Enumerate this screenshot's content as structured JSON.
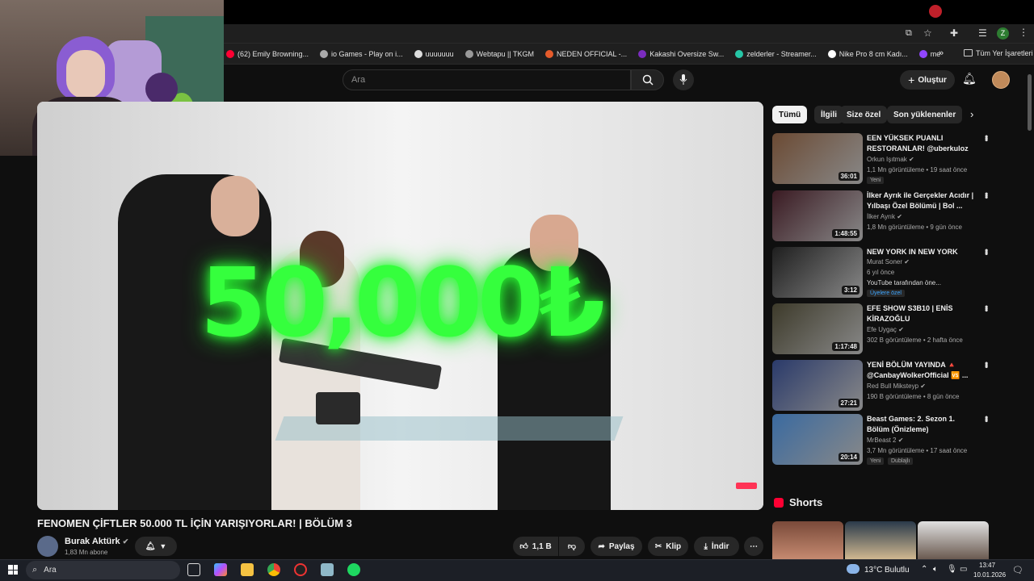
{
  "browser": {
    "bookmarks": [
      {
        "label": "(62) Emily Browning...",
        "icon": "youtube-icon",
        "color": "#ff0033"
      },
      {
        "label": "io Games - Play on i...",
        "icon": "games-icon",
        "color": "#aaaaaa"
      },
      {
        "label": "uuuuuuu",
        "icon": "github-icon",
        "color": "#dddddd"
      },
      {
        "label": "Webtapu || TKGM",
        "icon": "webtapu-icon",
        "color": "#999999"
      },
      {
        "label": "NEDEN OFFICIAL -...",
        "icon": "neden-icon",
        "color": "#e55b2b"
      },
      {
        "label": "Kakashi Oversize Sw...",
        "icon": "kakashi-icon",
        "color": "#7b2cbf"
      },
      {
        "label": "zelderler - Streamer...",
        "icon": "streamer-icon",
        "color": "#26c6a6"
      },
      {
        "label": "Nike Pro 8 cm Kadı...",
        "icon": "nike-icon",
        "color": "#ffffff"
      },
      {
        "label": "me",
        "icon": "twitch-icon",
        "color": "#9146ff"
      }
    ],
    "all_bookmarks": "Tüm Yer İşaretleri",
    "more": "»"
  },
  "header": {
    "search_placeholder": "Ara",
    "create_label": "Oluştur"
  },
  "video": {
    "overlay_text": "50,000₺",
    "title": "FENOMEN ÇİFTLER 50.000 TL İÇİN YARIŞIYORLAR! | BÖLÜM 3",
    "channel": "Burak Aktürk",
    "subscribers": "1,83 Mn abone",
    "likes": "1,1 B",
    "share": "Paylaş",
    "clip": "Klip",
    "download": "İndir"
  },
  "sidebar": {
    "chips": [
      "Tümü",
      "İlgili",
      "Size özel",
      "Son yüklenenler"
    ],
    "recommendations": [
      {
        "title": "EEN YÜKSEK PUANLI RESTORANLAR! @uberkuloz ...",
        "channel": "Orkun Işıtmak",
        "meta": "1,1 Mn görüntüleme • 19 saat önce",
        "badge": "Yeni",
        "duration": "36:01",
        "thumb_color": "#6b4a33"
      },
      {
        "title": "İlker Ayrık ile Gerçekler Acıdır | Yılbaşı Özel Bölümü | Bol ...",
        "channel": "İlker Ayrık",
        "meta": "1,8 Mn görüntüleme • 9 gün önce",
        "badge": "",
        "duration": "1:48:55",
        "thumb_color": "#3a1a22"
      },
      {
        "title": "NEW YORK IN NEW YORK",
        "channel": "Murat Soner",
        "meta": "6 yıl önce",
        "meta2": "YouTube tarafından öne...",
        "badge": "Üyelere özel",
        "duration": "3:12",
        "thumb_color": "#1e1e1e"
      },
      {
        "title": "EFE SHOW S3B10 | ENİS KİRAZOĞLU",
        "channel": "Efe Uygaç",
        "meta": "302 B görüntüleme • 2 hafta önce",
        "badge": "",
        "duration": "1:17:48",
        "thumb_color": "#3d3a2a"
      },
      {
        "title": "YENİ BÖLÜM YAYINDA 🔺 @CanbayWolkerOfficial 🆚 ...",
        "channel": "Red Bull Mikstеyp",
        "meta": "190 B görüntüleme • 8 gün önce",
        "badge": "",
        "duration": "27:21",
        "thumb_color": "#2a3a6a"
      },
      {
        "title": "Beast Games: 2. Sezon 1. Bölüm (Önizleme)",
        "channel": "MrBeast 2",
        "meta": "3,7 Mn görüntüleme • 17 saat önce",
        "badge": "Yeni",
        "badge2": "Dublajlı",
        "duration": "20:14",
        "thumb_color": "#3a6aa0"
      }
    ],
    "shorts_label": "Shorts"
  },
  "taskbar": {
    "search": "Ara",
    "weather": "13°C",
    "weather_desc": "Bulutlu",
    "time": "13:47",
    "date": "10.01.2026"
  }
}
